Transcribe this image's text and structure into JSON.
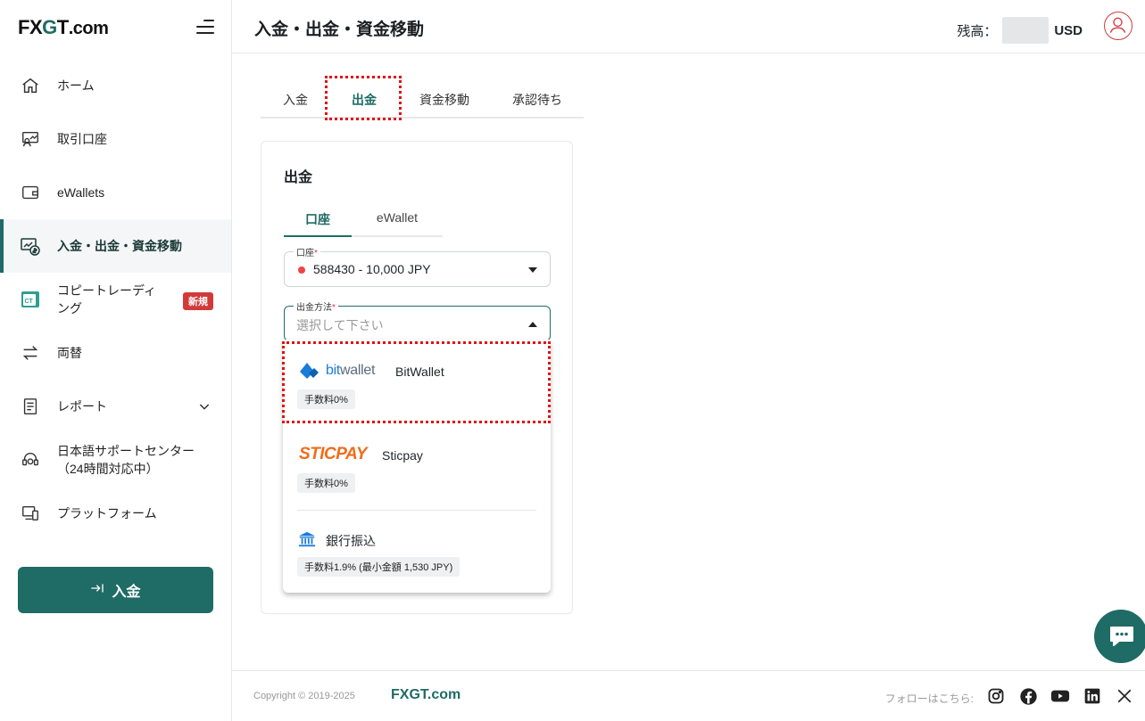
{
  "brand": {
    "logo_fx": "FX",
    "logo_g": "G",
    "logo_t": "T",
    "logo_com": ".com",
    "accent": "#1f6b66",
    "alert": "#d23a3a"
  },
  "sidebar": {
    "items": [
      {
        "label": "ホーム",
        "icon": "home-icon"
      },
      {
        "label": "取引口座",
        "icon": "trading-account-icon"
      },
      {
        "label": "eWallets",
        "icon": "wallet-icon"
      },
      {
        "label": "入金・出金・資金移動",
        "icon": "deposit-withdraw-icon"
      },
      {
        "label": "コピートレーディング",
        "icon": "copy-trading-icon",
        "badge": "新規"
      },
      {
        "label": "両替",
        "icon": "exchange-icon"
      },
      {
        "label": "レポート",
        "icon": "report-icon"
      },
      {
        "label": "日本語サポートセンター（24時間対応中）",
        "icon": "support-icon"
      },
      {
        "label": "プラットフォーム",
        "icon": "platform-icon"
      }
    ],
    "deposit_button": "入金"
  },
  "header": {
    "title": "入金・出金・資金移動",
    "balance_label": "残高：",
    "currency": "USD"
  },
  "tabs": [
    "入金",
    "出金",
    "資金移動",
    "承認待ち"
  ],
  "card": {
    "title": "出金",
    "subtabs": [
      "口座",
      "eWallet"
    ],
    "account_field": {
      "label": "口座",
      "required": "*",
      "value": "588430 - 10,000 JPY"
    },
    "method_field": {
      "label": "出金方法",
      "required": "*",
      "placeholder": "選択して下さい"
    }
  },
  "methods": [
    {
      "logo": "bitwallet",
      "logo_bit": "bit",
      "logo_wallet": "wallet",
      "name": "BitWallet",
      "fee": "手数料0%"
    },
    {
      "logo": "STICPAY",
      "name": "Sticpay",
      "fee": "手数料0%"
    },
    {
      "logo": "bank-icon",
      "name": "銀行振込",
      "fee": "手数料1.9% (最小金額 1,530 JPY)"
    }
  ],
  "footer": {
    "copyright": "Copyright © 2019-2025",
    "logo": "FXGT.com",
    "follow": "フォローはこちら:",
    "socials": [
      "instagram-icon",
      "facebook-icon",
      "youtube-icon",
      "linkedin-icon",
      "x-icon"
    ]
  }
}
